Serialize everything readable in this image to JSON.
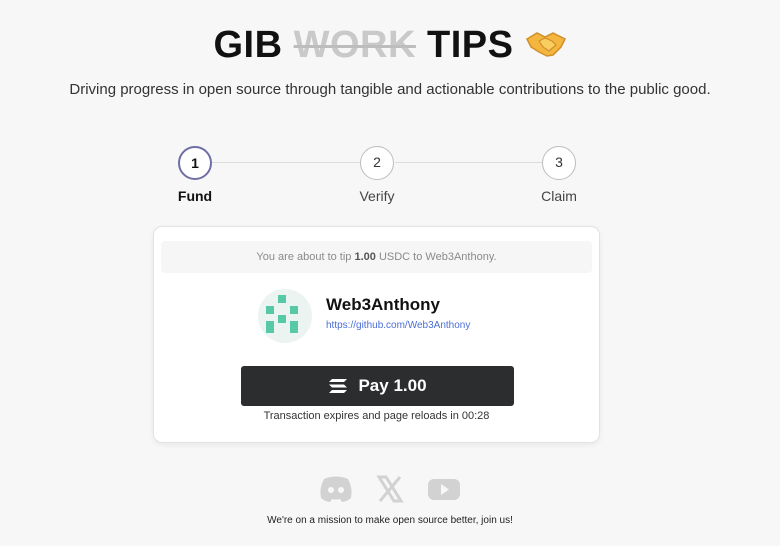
{
  "header": {
    "title_part1": "GIB",
    "title_struck": "WORK",
    "title_part2": "TIPS",
    "emoji_icon": "handshake-icon",
    "subtitle": "Driving progress in open source through tangible and actionable contributions to the public good."
  },
  "steps": [
    {
      "number": "1",
      "label": "Fund",
      "active": true
    },
    {
      "number": "2",
      "label": "Verify",
      "active": false
    },
    {
      "number": "3",
      "label": "Claim",
      "active": false
    }
  ],
  "tip_card": {
    "note_prefix": "You are about to tip ",
    "amount": "1.00",
    "note_suffix": " USDC to Web3Anthony.",
    "recipient_name": "Web3Anthony",
    "recipient_link": "https://github.com/Web3Anthony",
    "pay_label": "Pay 1.00",
    "pay_icon": "solana-icon",
    "expires_text": "Transaction expires and page reloads in 00:28"
  },
  "footer": {
    "social_icons": [
      "discord-icon",
      "x-icon",
      "youtube-icon"
    ],
    "mission": "We're on a mission to make open source better, join us!"
  },
  "colors": {
    "background": "#f7f7f7",
    "pay_button": "#2c2d2f",
    "link": "#4a6ed6",
    "avatar_accent": "#57c9a7",
    "active_step_border": "#6f6fa6"
  }
}
